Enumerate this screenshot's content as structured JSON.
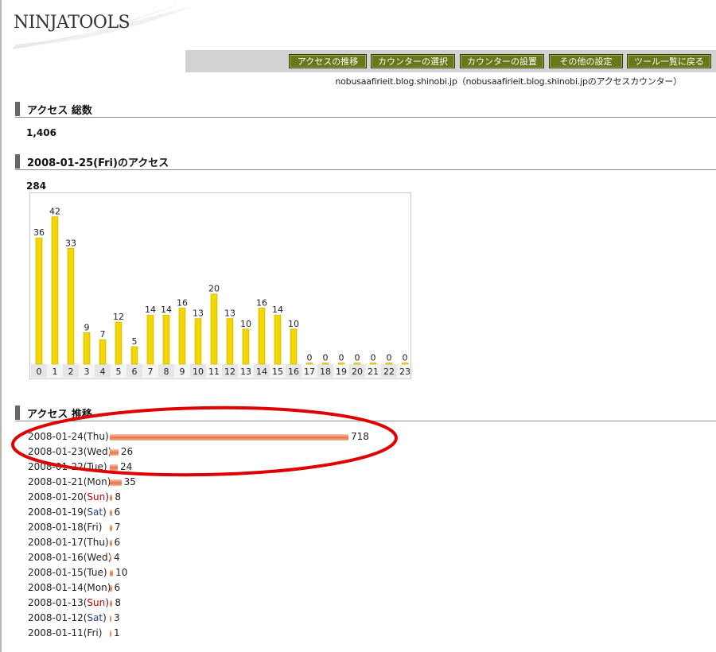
{
  "logo": {
    "text": "NINJATOOLS"
  },
  "nav": {
    "items": [
      "アクセスの推移",
      "カウンターの選択",
      "カウンターの設置",
      "その他の設定",
      "ツール一覧に戻る"
    ]
  },
  "site": {
    "line": "nobusaafirieit.blog.shinobi.jp（nobusaafirieit.blog.shinobi.jpのアクセスカウンター）"
  },
  "total": {
    "heading": "アクセス 総数",
    "value": "1,406"
  },
  "daily": {
    "heading": "2008-01-25(Fri)のアクセス",
    "value": "284"
  },
  "chart_data": {
    "type": "bar",
    "categories": [
      "0",
      "1",
      "2",
      "3",
      "4",
      "5",
      "6",
      "7",
      "8",
      "9",
      "10",
      "11",
      "12",
      "13",
      "14",
      "15",
      "16",
      "17",
      "18",
      "19",
      "20",
      "21",
      "22",
      "23"
    ],
    "values": [
      36,
      42,
      33,
      9,
      7,
      12,
      5,
      14,
      14,
      16,
      13,
      20,
      13,
      10,
      16,
      14,
      10,
      0,
      0,
      0,
      0,
      0,
      0,
      0
    ],
    "title": "",
    "xlabel": "",
    "ylabel": "",
    "ylim": [
      0,
      46
    ],
    "grid": false,
    "bar_color": "#f2d800"
  },
  "trend": {
    "heading": "アクセス 推移",
    "rows": [
      {
        "date": "2008-01-24",
        "day": "Thu",
        "value": 718
      },
      {
        "date": "2008-01-23",
        "day": "Wed",
        "value": 26
      },
      {
        "date": "2008-01-22",
        "day": "Tue",
        "value": 24
      },
      {
        "date": "2008-01-21",
        "day": "Mon",
        "value": 35
      },
      {
        "date": "2008-01-20",
        "day": "Sun",
        "value": 8
      },
      {
        "date": "2008-01-19",
        "day": "Sat",
        "value": 6
      },
      {
        "date": "2008-01-18",
        "day": "Fri",
        "value": 7
      },
      {
        "date": "2008-01-17",
        "day": "Thu",
        "value": 6
      },
      {
        "date": "2008-01-16",
        "day": "Wed",
        "value": 4
      },
      {
        "date": "2008-01-15",
        "day": "Tue",
        "value": 10
      },
      {
        "date": "2008-01-14",
        "day": "Mon",
        "value": 6
      },
      {
        "date": "2008-01-13",
        "day": "Sun",
        "value": 8
      },
      {
        "date": "2008-01-12",
        "day": "Sat",
        "value": 3
      },
      {
        "date": "2008-01-11",
        "day": "Fri",
        "value": 1
      }
    ]
  },
  "colors": {
    "nav_button": "#66771c",
    "sunday": "#c00000",
    "saturday": "#1f3f8f",
    "annotation": "#e00000",
    "trend_bar": "#e8744a"
  }
}
